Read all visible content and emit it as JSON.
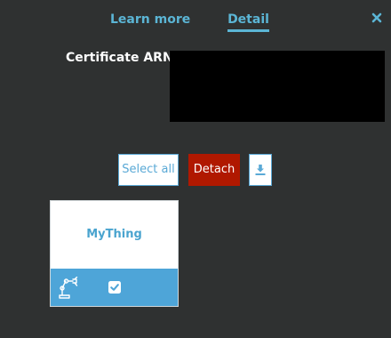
{
  "tabs": {
    "learn_more": "Learn more",
    "detail": "Detail",
    "active": "detail"
  },
  "close_icon": "close-icon",
  "certificate": {
    "label": "Certificate ARN",
    "value": ""
  },
  "toolbar": {
    "select_all": "Select all",
    "detach": "Detach",
    "download_icon": "download-icon"
  },
  "things": [
    {
      "name": "MyThing",
      "type_icon": "robot-arm-icon",
      "checked": true
    }
  ],
  "colors": {
    "background": "#2f3131",
    "accent": "#5bb5d5",
    "detach": "#b01800",
    "card_bar": "#4ea5d8"
  }
}
